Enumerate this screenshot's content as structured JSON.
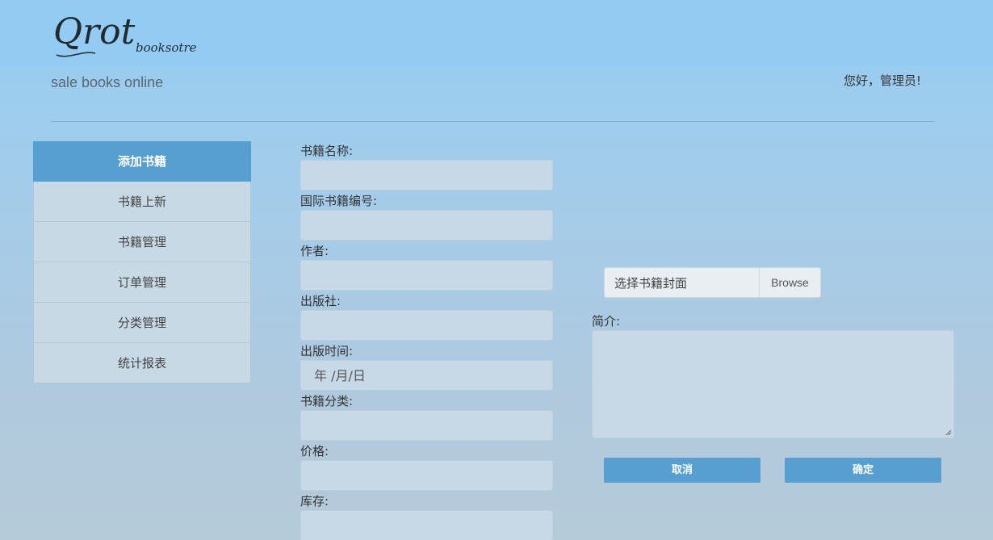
{
  "header": {
    "logo_main": "Qrot",
    "logo_sub": "booksotre",
    "tagline": "sale books online",
    "greeting": "您好，管理员!"
  },
  "sidebar": {
    "items": [
      {
        "label": "添加书籍",
        "active": true
      },
      {
        "label": "书籍上新",
        "active": false
      },
      {
        "label": "书籍管理",
        "active": false
      },
      {
        "label": "订单管理",
        "active": false
      },
      {
        "label": "分类管理",
        "active": false
      },
      {
        "label": "统计报表",
        "active": false
      }
    ]
  },
  "form": {
    "fields": [
      {
        "label": "书籍名称:",
        "value": ""
      },
      {
        "label": "国际书籍编号:",
        "value": ""
      },
      {
        "label": "作者:",
        "value": ""
      },
      {
        "label": "出版社:",
        "value": ""
      },
      {
        "label": "出版时间:",
        "value": "年 /月/日"
      },
      {
        "label": "书籍分类:",
        "value": ""
      },
      {
        "label": "价格:",
        "value": ""
      },
      {
        "label": "库存:",
        "value": ""
      }
    ],
    "cover_label": "选择书籍封面",
    "browse_label": "Browse",
    "intro_label": "简介:",
    "cancel_label": "取消",
    "confirm_label": "确定"
  },
  "colors": {
    "accent": "#569fd0",
    "input_bg": "#c7d9e6"
  }
}
